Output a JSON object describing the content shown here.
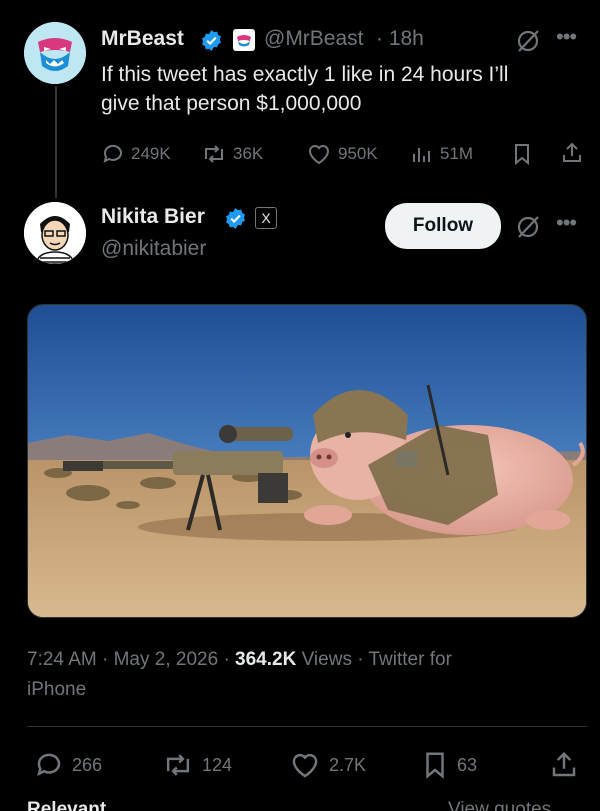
{
  "parent_tweet": {
    "name": "MrBeast",
    "handle": "@MrBeast",
    "time": "· 18h",
    "text_line1": "If this tweet has exactly 1 like in 24 hours I’ll",
    "text_line2": "give that person $1,000,000",
    "replies": "249K",
    "reposts": "36K",
    "likes": "950K",
    "views": "51M"
  },
  "reply_tweet": {
    "name": "Nikita Bier",
    "handle": "@nikitabier",
    "follow_label": "Follow",
    "badge_letter": "X",
    "timestamp": "7:24 AM · May 2, 2026 · ",
    "views_count": "364.2K",
    "views_label": " Views · Twitter for",
    "source_line2": "iPhone",
    "replies": "266",
    "reposts": "124",
    "likes": "2.7K",
    "bookmarks": "63"
  },
  "footer": {
    "left": "Relevant",
    "right": "View quotes"
  },
  "colors": {
    "background": "#000000",
    "verified": "#1d9bf0",
    "text": "#e7e9ea",
    "muted": "#71767b"
  }
}
